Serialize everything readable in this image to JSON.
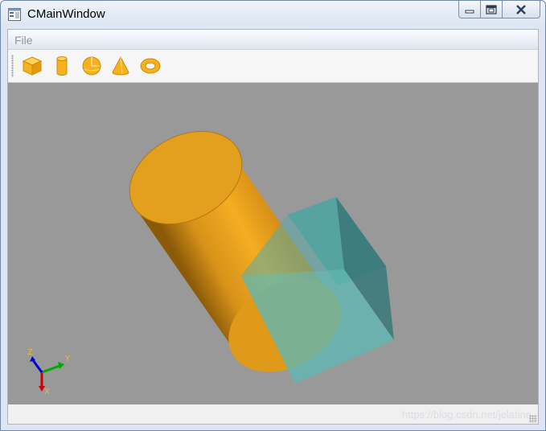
{
  "window": {
    "title": "CMainWindow",
    "caption_buttons": [
      "minimize",
      "maximize",
      "close"
    ]
  },
  "menubar": {
    "items": [
      {
        "label": "File"
      }
    ]
  },
  "toolbar": {
    "buttons": [
      {
        "icon": "box-icon"
      },
      {
        "icon": "cylinder-icon"
      },
      {
        "icon": "sphere-icon"
      },
      {
        "icon": "cone-icon"
      },
      {
        "icon": "torus-icon"
      }
    ]
  },
  "viewport": {
    "background": "#999999",
    "shapes": [
      {
        "name": "cylinder",
        "color": "#e8a21c"
      },
      {
        "name": "box",
        "color": "#5cb8b2"
      }
    ],
    "triad": {
      "x_label": "X",
      "y_label": "Y",
      "z_label": "Z",
      "x_color": "#cc0000",
      "y_color": "#00aa00",
      "z_color": "#0000cc"
    }
  },
  "statusbar": {
    "watermark": "https://blog.csdn.net/jelatine"
  },
  "colors": {
    "icon_fill": "#f5b21c",
    "icon_stroke": "#d18a0a"
  }
}
